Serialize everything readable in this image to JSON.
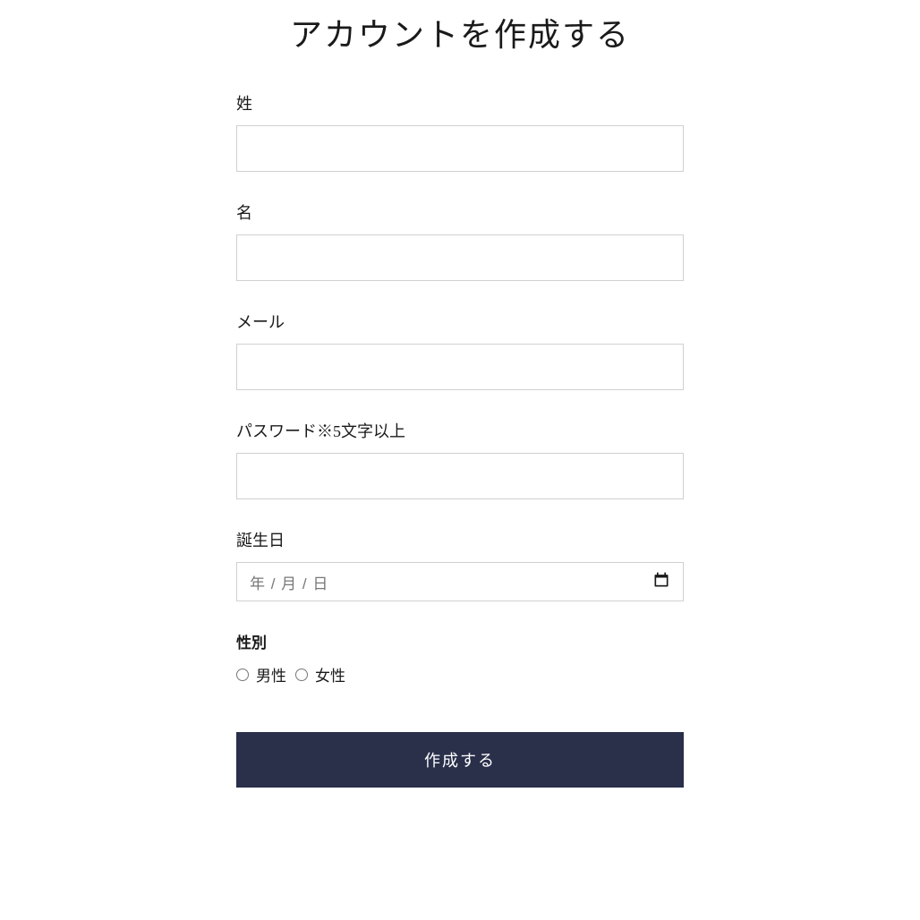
{
  "page": {
    "title": "アカウントを作成する"
  },
  "form": {
    "lastName": {
      "label": "姓",
      "value": ""
    },
    "firstName": {
      "label": "名",
      "value": ""
    },
    "email": {
      "label": "メール",
      "value": ""
    },
    "password": {
      "label": "パスワード※5文字以上",
      "value": ""
    },
    "birthday": {
      "label": "誕生日",
      "placeholder": "年 / 月 / 日",
      "value": ""
    },
    "gender": {
      "label": "性別",
      "options": {
        "male": "男性",
        "female": "女性"
      }
    },
    "submit": {
      "label": "作成する"
    }
  }
}
